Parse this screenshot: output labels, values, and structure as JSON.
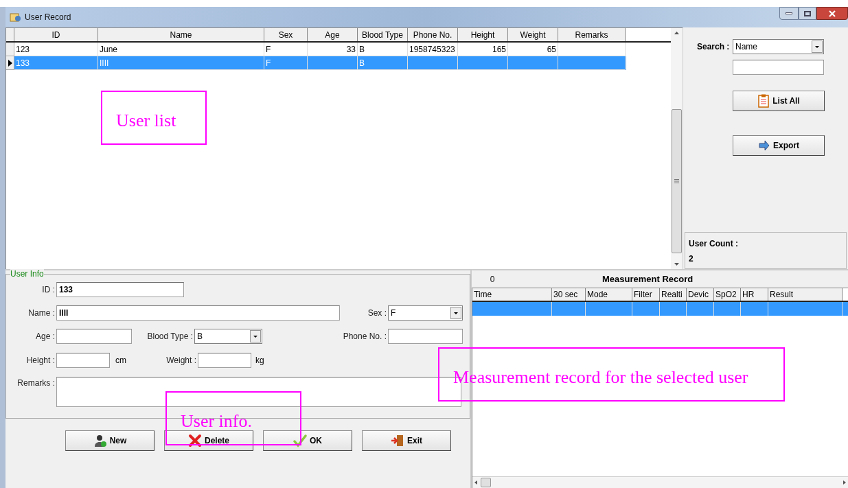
{
  "window": {
    "title": "User Record"
  },
  "user_table": {
    "columns": [
      {
        "label": "ID",
        "numeric": false
      },
      {
        "label": "Name",
        "numeric": false
      },
      {
        "label": "Sex",
        "numeric": false
      },
      {
        "label": "Age",
        "numeric": true
      },
      {
        "label": "Blood Type",
        "numeric": false
      },
      {
        "label": "Phone No.",
        "numeric": false
      },
      {
        "label": "Height",
        "numeric": true
      },
      {
        "label": "Weight",
        "numeric": true
      },
      {
        "label": "Remarks"
      }
    ],
    "rows": [
      {
        "selected": false,
        "cells": [
          "123",
          "June",
          "F",
          "33",
          "B",
          "1958745323",
          "165",
          "65",
          null
        ]
      },
      {
        "selected": true,
        "cells": [
          "133",
          "IIII",
          "F",
          null,
          "B",
          null,
          null,
          null,
          null
        ]
      }
    ]
  },
  "search": {
    "label": "Search :",
    "field": "Name"
  },
  "side_buttons": [
    {
      "label": "List All",
      "kind": "list"
    },
    {
      "label": "Export",
      "kind": "export"
    }
  ],
  "user_count": {
    "label": "User Count :",
    "value": "2"
  },
  "user_info": {
    "title": "User Info",
    "id": {
      "label": "ID :",
      "value": "133"
    },
    "name": {
      "label": "Name :",
      "value": "IIII"
    },
    "sex": {
      "label": "Sex :",
      "value": "F"
    },
    "age": {
      "label": "Age :"
    },
    "blood_type": {
      "label": "Blood Type :",
      "value": "B"
    },
    "phone": {
      "label": "Phone No. :"
    },
    "height": {
      "label": "Height :",
      "unit": "cm"
    },
    "weight": {
      "label": "Weight :",
      "unit": "kg"
    },
    "remarks": {
      "label": "Remarks :"
    }
  },
  "actions": [
    {
      "label": "New",
      "kind": "new"
    },
    {
      "label": "Delete",
      "kind": "delete"
    },
    {
      "label": "OK",
      "kind": "ok"
    },
    {
      "label": "Exit",
      "kind": "exit"
    }
  ],
  "measurement": {
    "count": "0",
    "title": "Measurement Record",
    "columns": [
      "Time",
      "30 sec",
      "Mode",
      "Filter",
      "Realti",
      "Devic",
      "SpO2",
      "HR",
      "Result"
    ],
    "rows": [
      {
        "selected": true
      }
    ]
  },
  "annotations": [
    {
      "text": "User list"
    },
    {
      "text": "Measurement record for the selected user"
    },
    {
      "text": "User info."
    }
  ]
}
